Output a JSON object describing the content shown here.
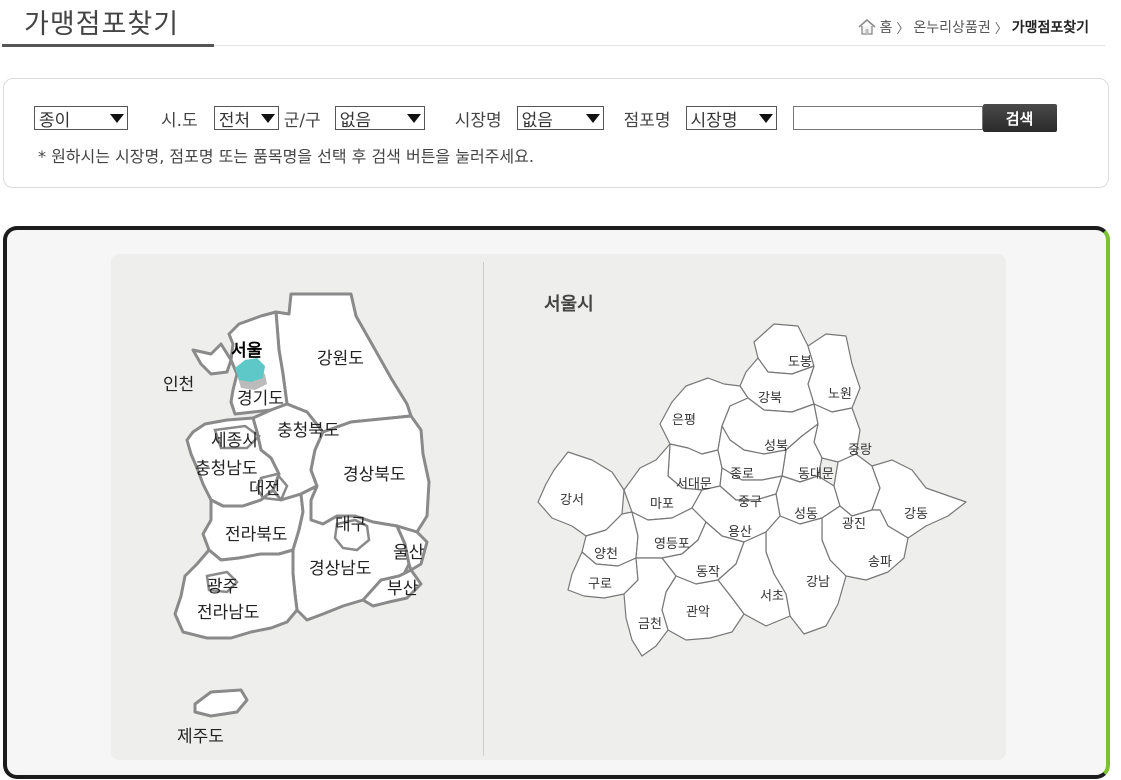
{
  "page": {
    "title": "가맹점포찾기",
    "breadcrumb": {
      "home": "홈",
      "section": "온누리상품권",
      "current": "가맹점포찾기"
    }
  },
  "search": {
    "type_select": "종이",
    "sido_label": "시.도",
    "sido_select": "전처",
    "gungu_label": "군/구",
    "gungu_select": "없음",
    "market_label": "시장명",
    "market_select": "없음",
    "store_label": "점포명",
    "store_select": "시장명",
    "keyword_value": "",
    "search_button": "검색",
    "hint": "* 원하시는 시장명, 점포명 또는 품목명을 선택 후 검색 버튼을 눌러주세요."
  },
  "korea_map": {
    "regions": [
      "서울",
      "인천",
      "강원도",
      "경기도",
      "세종시",
      "충청북도",
      "충청남도",
      "대전",
      "경상북도",
      "대구",
      "전라북도",
      "울산",
      "경상남도",
      "부산",
      "광주",
      "전라남도",
      "제주도"
    ],
    "selected": "서울",
    "highlight_color": "#5ec8c8"
  },
  "seoul_map": {
    "title": "서울시",
    "districts": [
      "도봉",
      "강북",
      "노원",
      "은평",
      "성북",
      "중랑",
      "서대문",
      "종로",
      "동대문",
      "강서",
      "마포",
      "중구",
      "성동",
      "광진",
      "강동",
      "용산",
      "양천",
      "영등포",
      "동작",
      "송파",
      "구로",
      "강남",
      "서초",
      "관악",
      "금천"
    ]
  }
}
